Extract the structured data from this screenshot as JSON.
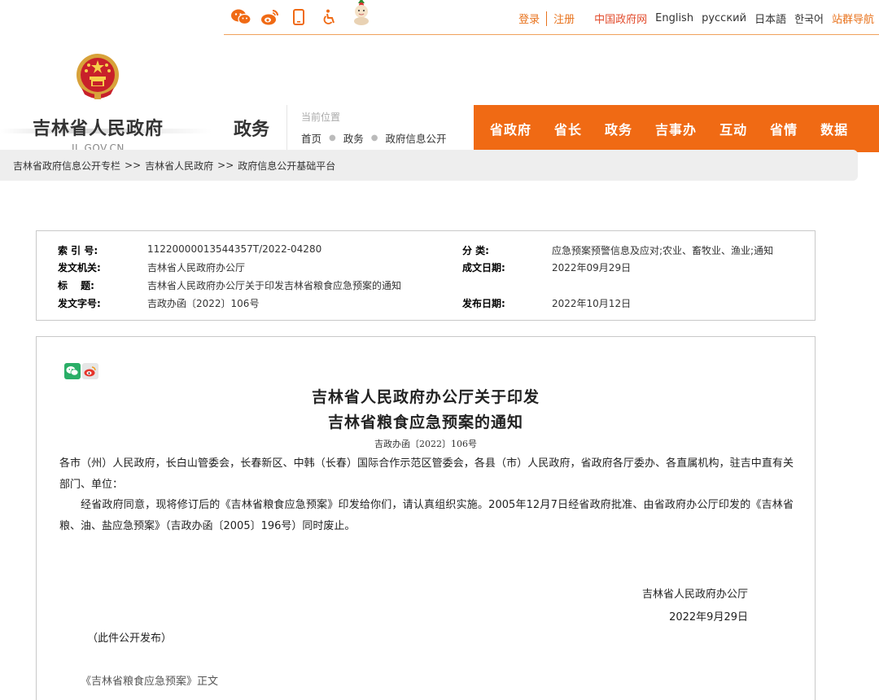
{
  "topbar": {
    "social_icons": [
      "wechat-icon",
      "weibo-icon",
      "mobile-icon",
      "accessibility-icon",
      "mascot-icon"
    ],
    "login": "登录",
    "register": "注册",
    "gov_portal": "中国政府网",
    "languages": [
      "English",
      "русский",
      "日本語",
      "한국어"
    ],
    "site_nav": "站群导航"
  },
  "header": {
    "site_title": "吉林省人民政府",
    "site_domain": "JL.GOV.CN",
    "section_name": "政务",
    "crumb_label": "当前位置",
    "crumb_path": [
      "首页",
      "政务",
      "政府信息公开"
    ],
    "nav_items": [
      "省政府",
      "省长",
      "政务",
      "吉事办",
      "互动",
      "省情",
      "数据"
    ]
  },
  "breadcrumb": {
    "items": [
      "吉林省政府信息公开专栏",
      "吉林省人民政府",
      "政府信息公开基础平台"
    ],
    "separator": ">>"
  },
  "meta": {
    "index_no_label": "索 引 号:",
    "index_no": "11220000013544357T/2022-04280",
    "category_label": "分 类:",
    "category": "应急预案预警信息及应对;农业、畜牧业、渔业;通知",
    "issuer_label": "发文机关:",
    "issuer": "吉林省人民政府办公厅",
    "created_label": "成文日期:",
    "created": "2022年09月29日",
    "title_label": "标　 题:",
    "title": "吉林省人民政府办公厅关于印发吉林省粮食应急预案的通知",
    "doc_no_label": "发文字号:",
    "doc_no": "吉政办函〔2022〕106号",
    "published_label": "发布日期:",
    "published": "2022年10月12日"
  },
  "article": {
    "share_icons": [
      "wechat-share-icon",
      "weibo-share-icon"
    ],
    "title_line1": "吉林省人民政府办公厅关于印发",
    "title_line2": "吉林省粮食应急预案的通知",
    "doc_number": "吉政办函〔2022〕106号",
    "recipients": "各市（州）人民政府，长白山管委会，长春新区、中韩（长春）国际合作示范区管委会，各县（市）人民政府，省政府各厅委办、各直属机构，驻吉中直有关部门、单位：",
    "body": "经省政府同意，现将修订后的《吉林省粮食应急预案》印发给你们，请认真组织实施。2005年12月7日经省政府批准、由省政府办公厅印发的《吉林省粮、油、盐应急预案》（吉政办函〔2005〕196号）同时废止。",
    "signer": "吉林省人民政府办公厅",
    "sign_date": "2022年9月29日",
    "public_note": "（此件公开发布）",
    "attachment": "《吉林省粮食应急预案》正文"
  },
  "colors": {
    "accent_orange": "#f06a14",
    "link_orange": "#e8731d",
    "gov_red": "#e24b2c"
  }
}
